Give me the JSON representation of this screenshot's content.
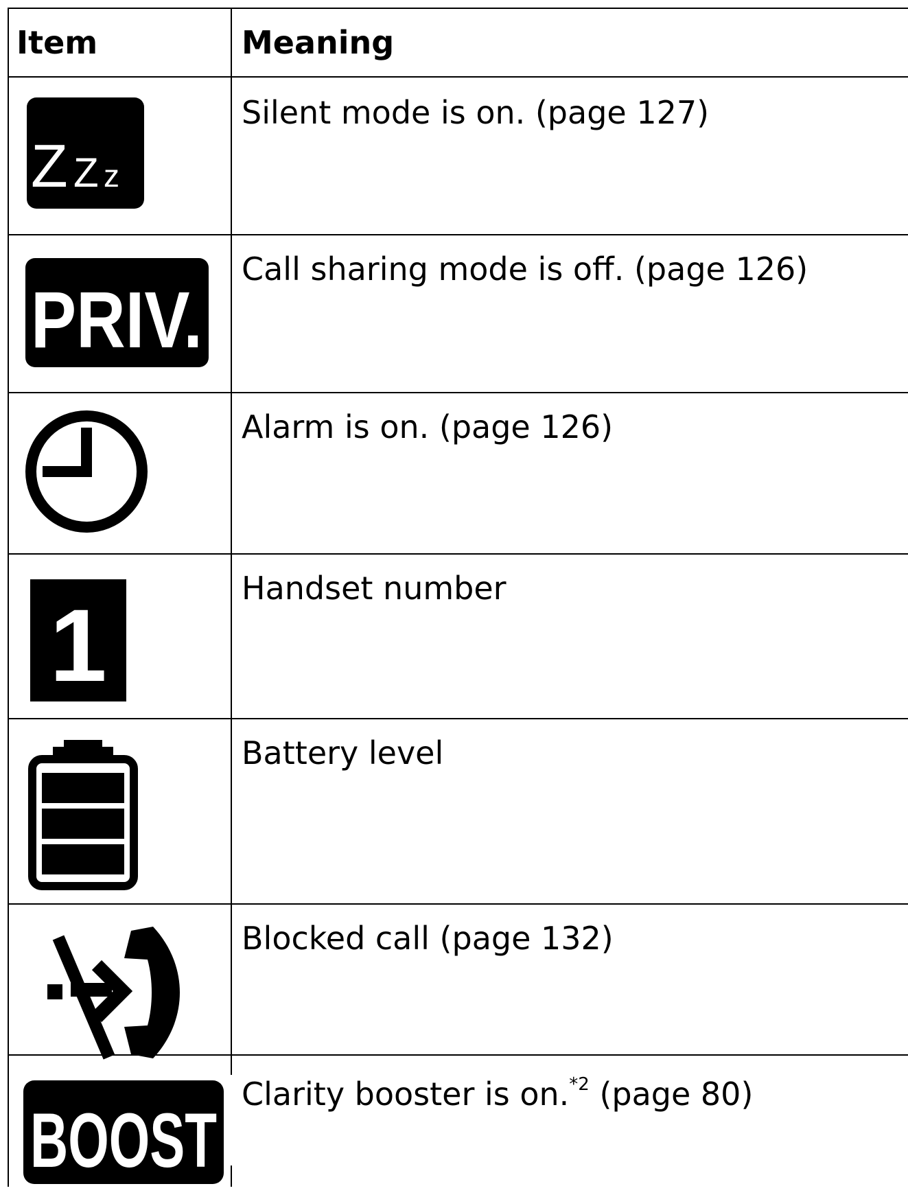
{
  "table": {
    "headers": {
      "item": "Item",
      "meaning": "Meaning"
    },
    "rows": [
      {
        "icon": "silent-mode-icon",
        "icon_text": "Zzz",
        "meaning": "Silent mode is on. (page 127)"
      },
      {
        "icon": "priv-icon",
        "icon_text": "PRIV.",
        "meaning": "Call sharing mode is off. (page 126)"
      },
      {
        "icon": "alarm-clock-icon",
        "meaning": "Alarm is on. (page 126)"
      },
      {
        "icon": "handset-number-icon",
        "icon_text": "1",
        "meaning": "Handset number"
      },
      {
        "icon": "battery-icon",
        "meaning": "Battery level"
      },
      {
        "icon": "blocked-call-icon",
        "meaning": "Blocked call (page 132)"
      },
      {
        "icon": "boost-icon",
        "icon_text": "BOOST",
        "meaning_main": "Clarity booster is on.",
        "meaning_sup": "*2",
        "meaning_tail": " (page 80)"
      }
    ]
  }
}
